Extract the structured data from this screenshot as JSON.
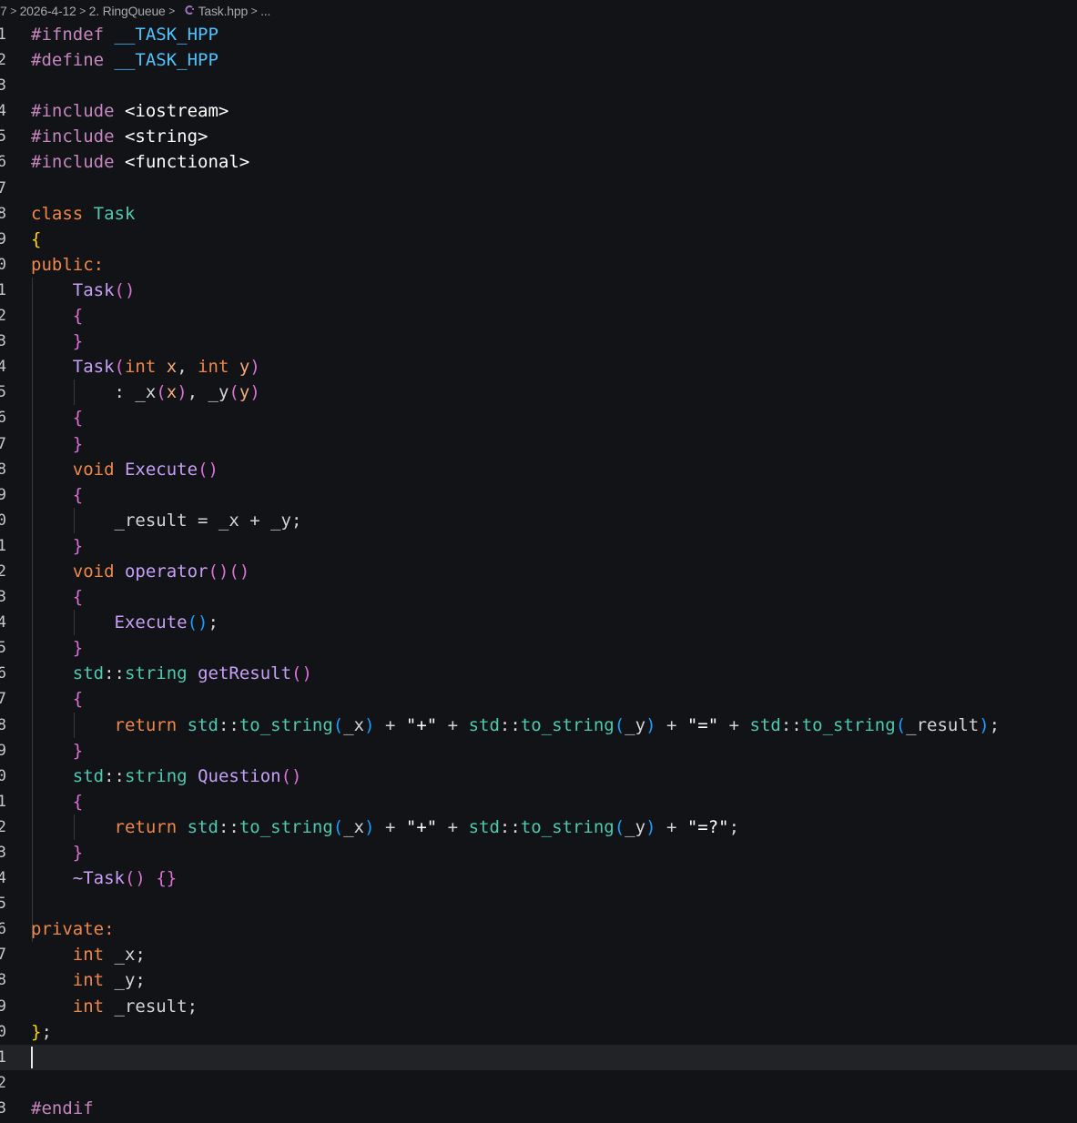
{
  "breadcrumb": {
    "items": [
      "7",
      "2026-4-12",
      "2. RingQueue",
      "Task.hpp",
      "..."
    ],
    "file_icon": "C++",
    "separator": ">"
  },
  "cursor_line": 41,
  "lines": [
    {
      "n": "1",
      "tokens": [
        [
          "directive",
          "#ifndef"
        ],
        [
          "plain",
          " "
        ],
        [
          "macro",
          "__TASK_HPP"
        ]
      ]
    },
    {
      "n": "2",
      "tokens": [
        [
          "directive",
          "#define"
        ],
        [
          "plain",
          " "
        ],
        [
          "macro",
          "__TASK_HPP"
        ]
      ]
    },
    {
      "n": "3",
      "tokens": []
    },
    {
      "n": "4",
      "tokens": [
        [
          "directive",
          "#include"
        ],
        [
          "plain",
          " "
        ],
        [
          "string",
          "<iostream>"
        ]
      ]
    },
    {
      "n": "5",
      "tokens": [
        [
          "directive",
          "#include"
        ],
        [
          "plain",
          " "
        ],
        [
          "string",
          "<string>"
        ]
      ]
    },
    {
      "n": "6",
      "tokens": [
        [
          "directive",
          "#include"
        ],
        [
          "plain",
          " "
        ],
        [
          "string",
          "<functional>"
        ]
      ]
    },
    {
      "n": "7",
      "tokens": []
    },
    {
      "n": "8",
      "tokens": [
        [
          "keyword",
          "class"
        ],
        [
          "plain",
          " "
        ],
        [
          "type",
          "Task"
        ]
      ]
    },
    {
      "n": "9",
      "tokens": [
        [
          "brace",
          "{"
        ]
      ]
    },
    {
      "n": "0",
      "tokens": [
        [
          "keyword",
          "public:"
        ]
      ]
    },
    {
      "n": "1",
      "tokens": [
        [
          "plain",
          "    "
        ],
        [
          "method",
          "Task"
        ],
        [
          "brace2",
          "()"
        ]
      ]
    },
    {
      "n": "2",
      "tokens": [
        [
          "plain",
          "    "
        ],
        [
          "brace2",
          "{"
        ]
      ]
    },
    {
      "n": "3",
      "tokens": [
        [
          "plain",
          "    "
        ],
        [
          "brace2",
          "}"
        ]
      ]
    },
    {
      "n": "4",
      "tokens": [
        [
          "plain",
          "    "
        ],
        [
          "method",
          "Task"
        ],
        [
          "brace2",
          "("
        ],
        [
          "keyword",
          "int"
        ],
        [
          "plain",
          " "
        ],
        [
          "param",
          "x"
        ],
        [
          "plain",
          ", "
        ],
        [
          "keyword",
          "int"
        ],
        [
          "plain",
          " "
        ],
        [
          "param",
          "y"
        ],
        [
          "brace2",
          ")"
        ]
      ]
    },
    {
      "n": "5",
      "tokens": [
        [
          "plain",
          "        : "
        ],
        [
          "plain",
          "_x"
        ],
        [
          "brace2",
          "("
        ],
        [
          "param",
          "x"
        ],
        [
          "brace2",
          ")"
        ],
        [
          "plain",
          ", "
        ],
        [
          "plain",
          "_y"
        ],
        [
          "brace2",
          "("
        ],
        [
          "param",
          "y"
        ],
        [
          "brace2",
          ")"
        ]
      ]
    },
    {
      "n": "6",
      "tokens": [
        [
          "plain",
          "    "
        ],
        [
          "brace2",
          "{"
        ]
      ]
    },
    {
      "n": "7",
      "tokens": [
        [
          "plain",
          "    "
        ],
        [
          "brace2",
          "}"
        ]
      ]
    },
    {
      "n": "8",
      "tokens": [
        [
          "plain",
          "    "
        ],
        [
          "keyword",
          "void"
        ],
        [
          "plain",
          " "
        ],
        [
          "method",
          "Execute"
        ],
        [
          "brace2",
          "()"
        ]
      ]
    },
    {
      "n": "9",
      "tokens": [
        [
          "plain",
          "    "
        ],
        [
          "brace2",
          "{"
        ]
      ]
    },
    {
      "n": "0",
      "tokens": [
        [
          "plain",
          "        "
        ],
        [
          "plain",
          "_result = _x + _y;"
        ]
      ]
    },
    {
      "n": "1",
      "tokens": [
        [
          "plain",
          "    "
        ],
        [
          "brace2",
          "}"
        ]
      ]
    },
    {
      "n": "2",
      "tokens": [
        [
          "plain",
          "    "
        ],
        [
          "keyword",
          "void"
        ],
        [
          "plain",
          " "
        ],
        [
          "method",
          "operator"
        ],
        [
          "brace2",
          "()()"
        ]
      ]
    },
    {
      "n": "3",
      "tokens": [
        [
          "plain",
          "    "
        ],
        [
          "brace2",
          "{"
        ]
      ]
    },
    {
      "n": "4",
      "tokens": [
        [
          "plain",
          "        "
        ],
        [
          "method",
          "Execute"
        ],
        [
          "brace3",
          "()"
        ],
        [
          "plain",
          ";"
        ]
      ]
    },
    {
      "n": "5",
      "tokens": [
        [
          "plain",
          "    "
        ],
        [
          "brace2",
          "}"
        ]
      ]
    },
    {
      "n": "6",
      "tokens": [
        [
          "plain",
          "    "
        ],
        [
          "ns",
          "std"
        ],
        [
          "plain",
          "::"
        ],
        [
          "type",
          "string"
        ],
        [
          "plain",
          " "
        ],
        [
          "method",
          "getResult"
        ],
        [
          "brace2",
          "()"
        ]
      ]
    },
    {
      "n": "7",
      "tokens": [
        [
          "plain",
          "    "
        ],
        [
          "brace2",
          "{"
        ]
      ]
    },
    {
      "n": "8",
      "tokens": [
        [
          "plain",
          "        "
        ],
        [
          "keyword",
          "return"
        ],
        [
          "plain",
          " "
        ],
        [
          "ns",
          "std"
        ],
        [
          "plain",
          "::"
        ],
        [
          "type",
          "to_string"
        ],
        [
          "brace3",
          "("
        ],
        [
          "plain",
          "_x"
        ],
        [
          "brace3",
          ")"
        ],
        [
          "plain",
          " + "
        ],
        [
          "string",
          "\"+\""
        ],
        [
          "plain",
          " + "
        ],
        [
          "ns",
          "std"
        ],
        [
          "plain",
          "::"
        ],
        [
          "type",
          "to_string"
        ],
        [
          "brace3",
          "("
        ],
        [
          "plain",
          "_y"
        ],
        [
          "brace3",
          ")"
        ],
        [
          "plain",
          " + "
        ],
        [
          "string",
          "\"=\""
        ],
        [
          "plain",
          " + "
        ],
        [
          "ns",
          "std"
        ],
        [
          "plain",
          "::"
        ],
        [
          "type",
          "to_string"
        ],
        [
          "brace3",
          "("
        ],
        [
          "plain",
          "_result"
        ],
        [
          "brace3",
          ")"
        ],
        [
          "plain",
          ";"
        ]
      ]
    },
    {
      "n": "9",
      "tokens": [
        [
          "plain",
          "    "
        ],
        [
          "brace2",
          "}"
        ]
      ]
    },
    {
      "n": "0",
      "tokens": [
        [
          "plain",
          "    "
        ],
        [
          "ns",
          "std"
        ],
        [
          "plain",
          "::"
        ],
        [
          "type",
          "string"
        ],
        [
          "plain",
          " "
        ],
        [
          "method",
          "Question"
        ],
        [
          "brace2",
          "()"
        ]
      ]
    },
    {
      "n": "1",
      "tokens": [
        [
          "plain",
          "    "
        ],
        [
          "brace2",
          "{"
        ]
      ]
    },
    {
      "n": "2",
      "tokens": [
        [
          "plain",
          "        "
        ],
        [
          "keyword",
          "return"
        ],
        [
          "plain",
          " "
        ],
        [
          "ns",
          "std"
        ],
        [
          "plain",
          "::"
        ],
        [
          "type",
          "to_string"
        ],
        [
          "brace3",
          "("
        ],
        [
          "plain",
          "_x"
        ],
        [
          "brace3",
          ")"
        ],
        [
          "plain",
          " + "
        ],
        [
          "string",
          "\"+\""
        ],
        [
          "plain",
          " + "
        ],
        [
          "ns",
          "std"
        ],
        [
          "plain",
          "::"
        ],
        [
          "type",
          "to_string"
        ],
        [
          "brace3",
          "("
        ],
        [
          "plain",
          "_y"
        ],
        [
          "brace3",
          ")"
        ],
        [
          "plain",
          " + "
        ],
        [
          "string",
          "\"=?\""
        ],
        [
          "plain",
          ";"
        ]
      ]
    },
    {
      "n": "3",
      "tokens": [
        [
          "plain",
          "    "
        ],
        [
          "brace2",
          "}"
        ]
      ]
    },
    {
      "n": "4",
      "tokens": [
        [
          "plain",
          "    "
        ],
        [
          "method",
          "~Task"
        ],
        [
          "brace2",
          "()"
        ],
        [
          "plain",
          " "
        ],
        [
          "brace2",
          "{}"
        ]
      ]
    },
    {
      "n": "5",
      "tokens": []
    },
    {
      "n": "6",
      "tokens": [
        [
          "keyword",
          "private:"
        ]
      ]
    },
    {
      "n": "7",
      "tokens": [
        [
          "plain",
          "    "
        ],
        [
          "keyword",
          "int"
        ],
        [
          "plain",
          " _x;"
        ]
      ]
    },
    {
      "n": "8",
      "tokens": [
        [
          "plain",
          "    "
        ],
        [
          "keyword",
          "int"
        ],
        [
          "plain",
          " _y;"
        ]
      ]
    },
    {
      "n": "9",
      "tokens": [
        [
          "plain",
          "    "
        ],
        [
          "keyword",
          "int"
        ],
        [
          "plain",
          " _result;"
        ]
      ]
    },
    {
      "n": "0",
      "tokens": [
        [
          "brace",
          "}"
        ],
        [
          "plain",
          ";"
        ]
      ]
    },
    {
      "n": "1",
      "tokens": []
    },
    {
      "n": "2",
      "tokens": []
    },
    {
      "n": "3",
      "tokens": [
        [
          "directive",
          "#endif"
        ]
      ]
    }
  ]
}
